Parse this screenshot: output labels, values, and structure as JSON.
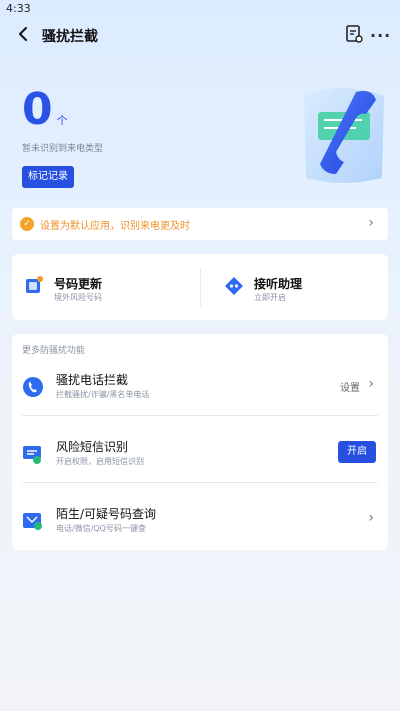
{
  "status_bar": {
    "time": "4:33"
  },
  "header": {
    "title": "骚扰拦截"
  },
  "summary": {
    "count": "0",
    "unit": "个",
    "subtitle": "暂未识别到来电类型",
    "record_button": "标记记录"
  },
  "notice": {
    "text": "设置为默认应用，识别来电更及时"
  },
  "quick": [
    {
      "title": "号码更新",
      "subtitle": "境外风险号码"
    },
    {
      "title": "接听助理",
      "subtitle": "立即开启"
    }
  ],
  "more": {
    "section_title": "更多防骚扰功能",
    "items": [
      {
        "title": "骚扰电话拦截",
        "subtitle": "拦截骚扰/诈骗/黑名单电话",
        "action": "设置"
      },
      {
        "title": "风险短信识别",
        "subtitle": "开启权限，启用短信识别",
        "action": "开启"
      },
      {
        "title": "陌生/可疑号码查询",
        "subtitle": "电话/微信/QQ号码一键查"
      }
    ]
  },
  "colors": {
    "accent": "#2750e0",
    "warning": "#f0932b",
    "page_bg": "#eef3fa"
  }
}
